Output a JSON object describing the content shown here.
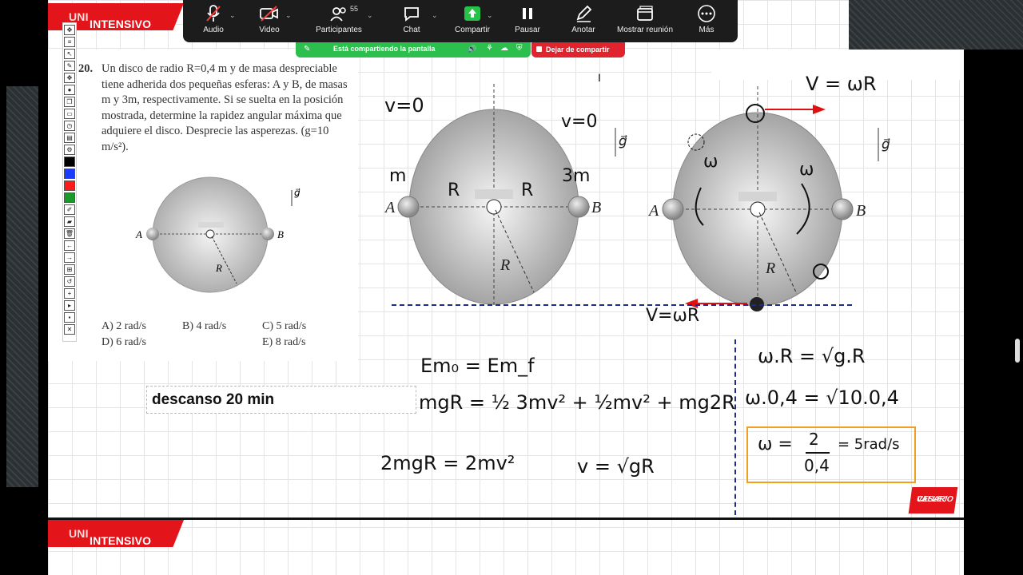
{
  "brand": {
    "name": "INTENSIVO",
    "accent": "UNI",
    "color": "#e4141b"
  },
  "logo": {
    "line1": "CESAR",
    "line2": "VALLEJO"
  },
  "zoom_toolbar": {
    "items": [
      {
        "label": "Audio",
        "icon": "mic-muted-icon"
      },
      {
        "label": "Video",
        "icon": "video-off-icon"
      },
      {
        "label": "Participantes",
        "icon": "participants-icon",
        "count": "55"
      },
      {
        "label": "Chat",
        "icon": "chat-icon"
      },
      {
        "label": "Compartir",
        "icon": "share-screen-icon"
      },
      {
        "label": "Pausar",
        "icon": "pause-icon"
      },
      {
        "label": "Anotar",
        "icon": "pencil-icon"
      },
      {
        "label": "Mostrar reunión",
        "icon": "window-icon"
      },
      {
        "label": "Más",
        "icon": "more-icon"
      }
    ],
    "sharing_text": "Está compartiendo la pantalla",
    "stop_share": "Dejar de compartir"
  },
  "problem": {
    "number": "20.",
    "text": "Un disco de radio R=0,4 m y de masa despreciable tiene adherida dos pequeñas esferas: A y B, de masas m y 3m, respectivamente. Si se suelta en la posición mostrada, determine la rapidez angular máxima que adquiere el disco. Desprecie las asperezas. (g=10 m/s²).",
    "options": [
      "A) 2 rad/s",
      "B) 4 rad/s",
      "C) 5 rad/s",
      "D) 6 rad/s",
      "E) 8 rad/s"
    ],
    "figure": {
      "label_a": "A",
      "label_b": "B",
      "label_r": "R",
      "label_g": "g⃗"
    }
  },
  "note": "descanso 20 min",
  "handwriting": {
    "v0": "v=0",
    "v0b": "v=0",
    "m": "m",
    "m3": "3m",
    "R1": "R",
    "R2": "R",
    "vtop": "V = ωR",
    "vbottom": "V=ωR",
    "w1": "ω",
    "w2": "ω",
    "eq1": "Em₀ = Em_f",
    "eq2": "mgR = ½ 3mv² + ½mv² + mg2R",
    "eq3": "2mgR = 2mv²",
    "eq4": "v = √gR",
    "eq5": "ω.R = √g.R",
    "eq6": "ω.0,4 = √10.0,4",
    "eq7_left": "ω = ",
    "eq7_num": "2",
    "eq7_den": "0,4",
    "eq7_right": "= 5rad/s"
  }
}
